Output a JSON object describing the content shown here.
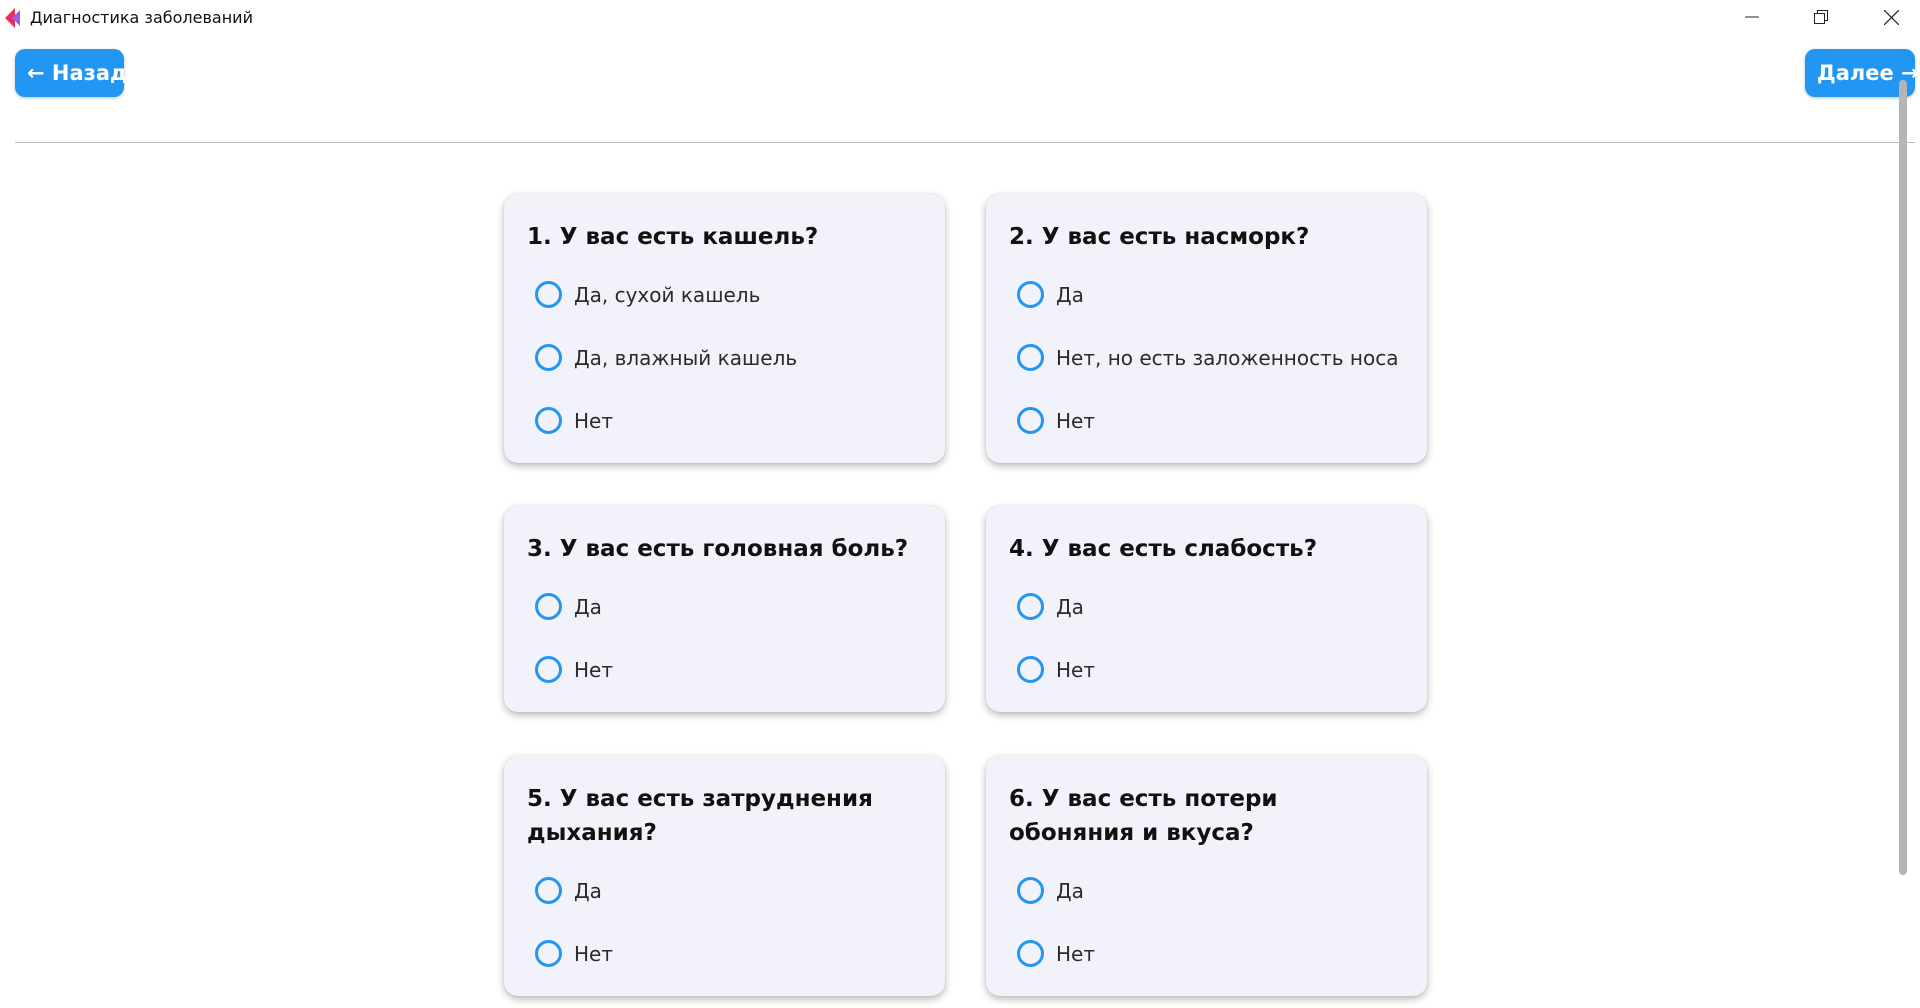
{
  "window": {
    "title": "Диагностика заболеваний",
    "controls": [
      "minimize-icon",
      "restore-icon",
      "close-icon"
    ]
  },
  "nav": {
    "back_label": "← Назад",
    "next_label": "Далее →"
  },
  "colors": {
    "accent": "#2196f3",
    "card_bg": "#f2f2fa"
  },
  "questions": [
    {
      "title": "1. У вас есть кашель?",
      "options": [
        "Да, сухой кашель",
        "Да, влажный кашель",
        "Нет"
      ]
    },
    {
      "title": "2. У вас есть насморк?",
      "options": [
        "Да",
        "Нет, но есть заложенность носа",
        "Нет"
      ]
    },
    {
      "title": "3. У вас есть головная боль?",
      "options": [
        "Да",
        "Нет"
      ]
    },
    {
      "title": "4. У вас есть слабость?",
      "options": [
        "Да",
        "Нет"
      ]
    },
    {
      "title": "5. У вас есть затруднения дыхания?",
      "options": [
        "Да",
        "Нет"
      ]
    },
    {
      "title": "6. У вас есть потери обоняния и вкуса?",
      "options": [
        "Да",
        "Нет"
      ]
    }
  ]
}
